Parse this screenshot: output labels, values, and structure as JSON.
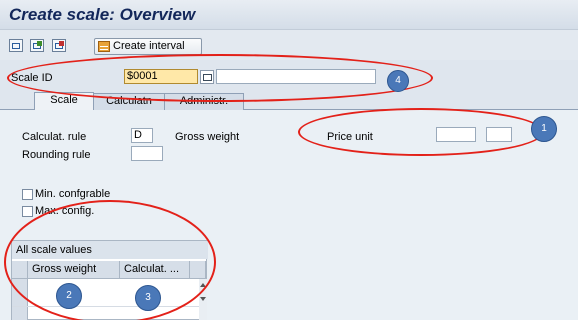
{
  "window": {
    "title": "Create scale: Overview"
  },
  "toolbar": {
    "create_interval_label": "Create interval"
  },
  "scale": {
    "id_label": "Scale ID",
    "id_value": "$0001"
  },
  "tabs": [
    {
      "label": "Scale"
    },
    {
      "label": "Calculatn"
    },
    {
      "label": "Administr."
    }
  ],
  "details": {
    "calc_rule_label": "Calculat. rule",
    "calc_rule_value": "D",
    "calc_rule_desc": "Gross weight",
    "price_unit_label": "Price unit",
    "rounding_rule_label": "Rounding rule",
    "min_config_label": "Min. confgrable",
    "max_config_label": "Max. config."
  },
  "table": {
    "title": "All scale values",
    "columns": [
      "Gross weight",
      "Calculat. ..."
    ]
  },
  "markers": [
    "1",
    "2",
    "3",
    "4"
  ],
  "colors": {
    "highlight": "#e32119",
    "marker": "#4a78b8",
    "title_text": "#13275a"
  }
}
